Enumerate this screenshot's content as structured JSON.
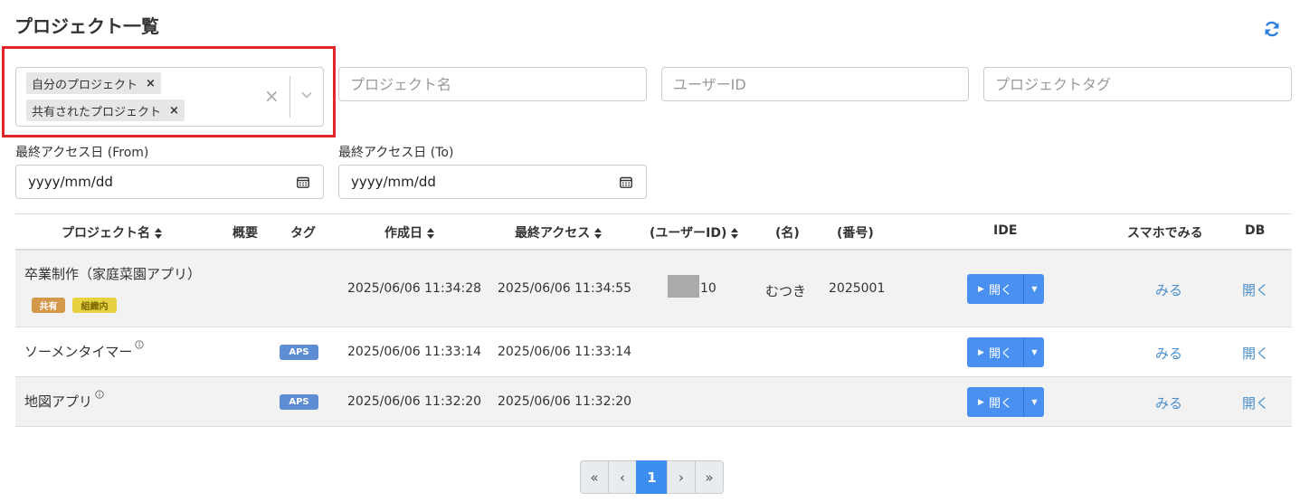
{
  "page_title": "プロジェクト一覧",
  "filters": {
    "type_chips": [
      "自分のプロジェクト",
      "共有されたプロジェクト"
    ],
    "chip_remove": "×",
    "clear": "×",
    "project_name_placeholder": "プロジェクト名",
    "user_id_placeholder": "ユーザーID",
    "project_tag_placeholder": "プロジェクトタグ",
    "date_from_label": "最終アクセス日 (From)",
    "date_to_label": "最終アクセス日 (To)",
    "date_format": "yyyy/mm/dd"
  },
  "table": {
    "headers": {
      "name": "プロジェクト名",
      "summary": "概要",
      "tag": "タグ",
      "created": "作成日",
      "last_access": "最終アクセス",
      "user_id": "(ユーザーID)",
      "display_name": "(名)",
      "number": "(番号)",
      "ide": "IDE",
      "smartphone": "スマホでみる",
      "db": "DB"
    },
    "rows": [
      {
        "name": "卒業制作（家庭菜園アプリ）",
        "badges": [
          "共有",
          "組織内"
        ],
        "tag": "",
        "created": "2025/06/06 11:34:28",
        "last_access": "2025/06/06 11:34:55",
        "user_id_suffix": "10",
        "display_name": "むつき",
        "number": "2025001",
        "ide_label": "開く",
        "view_label": "みる",
        "db_label": "開く"
      },
      {
        "name": "ソーメンタイマー",
        "badges": [],
        "tag": "APS",
        "created": "2025/06/06 11:33:14",
        "last_access": "2025/06/06 11:33:14",
        "user_id_suffix": "",
        "display_name": "",
        "number": "",
        "ide_label": "開く",
        "view_label": "みる",
        "db_label": "開く"
      },
      {
        "name": "地図アプリ",
        "badges": [],
        "tag": "APS",
        "created": "2025/06/06 11:32:20",
        "last_access": "2025/06/06 11:32:20",
        "user_id_suffix": "",
        "display_name": "",
        "number": "",
        "ide_label": "開く",
        "view_label": "みる",
        "db_label": "開く"
      }
    ]
  },
  "pagination": {
    "first": "«",
    "prev": "‹",
    "current": "1",
    "next": "›",
    "last": "»"
  },
  "colors": {
    "accent": "#4a90f0",
    "highlight": "#e0262b",
    "link": "#4a8fc9",
    "badge_shared": "#d4984b",
    "badge_org": "#e8d141",
    "badge_aps": "#5f8dd3"
  }
}
